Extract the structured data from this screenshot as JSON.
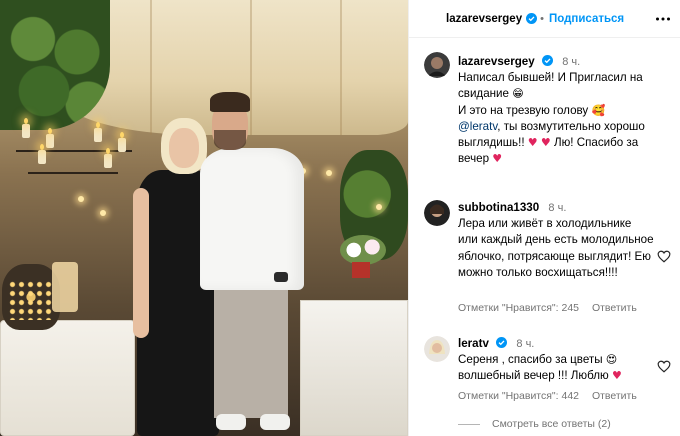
{
  "post": {
    "author": "lazarevsergey",
    "follow_label": "Подписаться"
  },
  "caption": {
    "username": "lazarevsergey",
    "time": "8 ч.",
    "line1": "Написал бывшей! И Пригласил на свидание",
    "line2": "И это на трезвую голову",
    "mention": "@leratv",
    "line3_rest": ", ты возмутительно хорошо выглядишь!!",
    "line3_tail": "Лю! Спасибо за вечер"
  },
  "comments": [
    {
      "username": "subbotina1330",
      "time": "8 ч.",
      "text": "Лера или живёт в холодильнике или каждый день есть молодильное яблочко, потрясающе выглядит! Ею можно только восхищаться!!!!",
      "likes": "Отметки \"Нравится\": 245",
      "reply": "Ответить"
    },
    {
      "username": "leratv",
      "time": "8 ч.",
      "text": "Сереня , спасибо за цветы",
      "text2": "волшебный вечер !!! Люблю",
      "likes": "Отметки \"Нравится\": 442",
      "reply": "Ответить",
      "view_replies": "Смотреть все ответы (2)"
    }
  ],
  "colors": {
    "link": "#0095f6",
    "mention": "#00376b",
    "secondary_text": "#737373",
    "heart": "#e0245e"
  },
  "icons": [
    "verified-badge-icon",
    "more-options-icon",
    "heart-outline-icon",
    "red-heart-emoji",
    "smile-emoji",
    "heart-eyes-emoji",
    "blush-kiss-emoji"
  ]
}
